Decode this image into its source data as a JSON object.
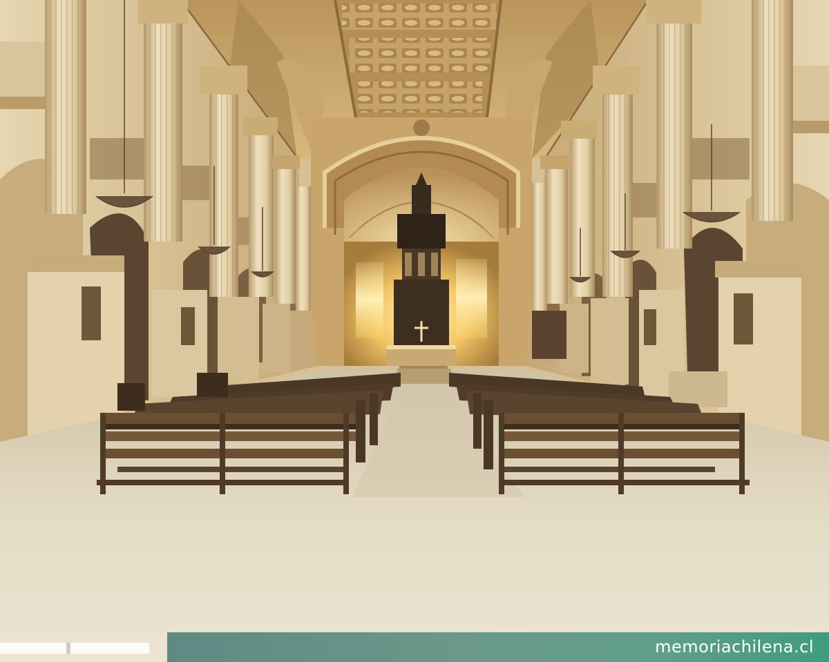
{
  "photo": {
    "subject": "",
    "palette": {
      "vault": "#c9a46a",
      "vault_shadow": "#7d5f36",
      "column": "#e3d0a8",
      "column_shadow": "#a98f63",
      "apse_glow": "#ffd873",
      "floor": "#e6ddc8",
      "pew": "#6a4f33",
      "pew_dark": "#3e2c1c",
      "altar_dark": "#3a2b1f"
    }
  },
  "watermark": {
    "text": "memoriachilena.cl",
    "color": "#ffffff",
    "bar_color": "#5f9e8a"
  }
}
